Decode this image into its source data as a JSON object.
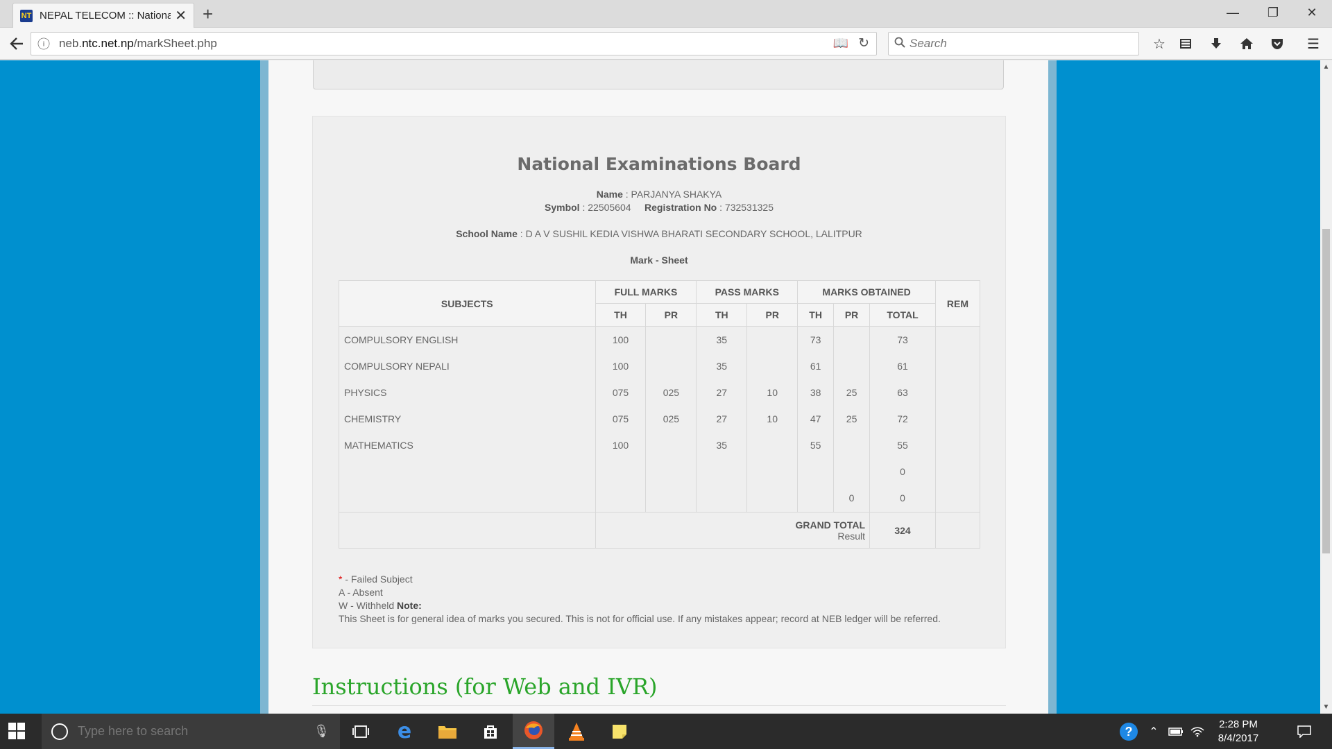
{
  "browser": {
    "tab_title": "NEPAL TELECOM :: National",
    "favicon_text": "NT",
    "url_prefix": "neb.",
    "url_domain": "ntc.net.np",
    "url_path": "/markSheet.php",
    "search_placeholder": "Search",
    "icons": [
      "back-arrow-icon",
      "info-icon",
      "reader-view-icon",
      "reload-icon",
      "search-icon",
      "star-icon",
      "library-icon",
      "download-icon",
      "home-icon",
      "pocket-icon",
      "menu-icon"
    ]
  },
  "marksheet": {
    "board_title": "National Examinations Board",
    "name_label": "Name",
    "name_value": "PARJANYA SHAKYA",
    "symbol_label": "Symbol",
    "symbol_value": "22505604",
    "reg_label": "Registration No",
    "reg_value": "732531325",
    "school_label": "School Name",
    "school_value": "D A V SUSHIL KEDIA VISHWA BHARATI SECONDARY SCHOOL, LALITPUR",
    "sheet_title": "Mark - Sheet",
    "headers": {
      "subjects": "SUBJECTS",
      "full_marks": "FULL MARKS",
      "pass_marks": "PASS MARKS",
      "marks_obtained": "MARKS OBTAINED",
      "rem": "REM",
      "th": "TH",
      "pr": "PR",
      "total": "TOTAL"
    },
    "rows": [
      {
        "subject": "COMPULSORY ENGLISH",
        "full_th": "100",
        "full_pr": "",
        "pass_th": "35",
        "pass_pr": "",
        "obt_th": "73",
        "obt_pr": "",
        "total": "73",
        "rem": ""
      },
      {
        "subject": "COMPULSORY NEPALI",
        "full_th": "100",
        "full_pr": "",
        "pass_th": "35",
        "pass_pr": "",
        "obt_th": "61",
        "obt_pr": "",
        "total": "61",
        "rem": ""
      },
      {
        "subject": "PHYSICS",
        "full_th": "075",
        "full_pr": "025",
        "pass_th": "27",
        "pass_pr": "10",
        "obt_th": "38",
        "obt_pr": "25",
        "total": "63",
        "rem": ""
      },
      {
        "subject": "CHEMISTRY",
        "full_th": "075",
        "full_pr": "025",
        "pass_th": "27",
        "pass_pr": "10",
        "obt_th": "47",
        "obt_pr": "25",
        "total": "72",
        "rem": ""
      },
      {
        "subject": "MATHEMATICS",
        "full_th": "100",
        "full_pr": "",
        "pass_th": "35",
        "pass_pr": "",
        "obt_th": "55",
        "obt_pr": "",
        "total": "55",
        "rem": ""
      },
      {
        "subject": "",
        "full_th": "",
        "full_pr": "",
        "pass_th": "",
        "pass_pr": "",
        "obt_th": "",
        "obt_pr": "",
        "total": "0",
        "rem": ""
      },
      {
        "subject": "",
        "full_th": "",
        "full_pr": "",
        "pass_th": "",
        "pass_pr": "",
        "obt_th": "",
        "obt_pr": "0",
        "total": "0",
        "rem": ""
      }
    ],
    "grand_total_label": "GRAND TOTAL",
    "result_label": "Result",
    "grand_total_value": "324",
    "legend_failed_mark": "*",
    "legend_failed": " - Failed Subject",
    "legend_absent": "A - Absent",
    "legend_withheld": "W - Withheld",
    "note_label": "Note:",
    "note_text": "This Sheet is for general idea of marks you secured. This is not for official use. If any mistakes appear; record at NEB ledger will be referred."
  },
  "instructions_heading": "Instructions (for Web and IVR)",
  "taskbar": {
    "search_placeholder": "Type here to search",
    "time": "2:28 PM",
    "date": "8/4/2017",
    "apps": [
      "task-view-icon",
      "edge-icon",
      "file-explorer-icon",
      "store-icon",
      "firefox-icon",
      "vlc-icon",
      "sticky-notes-icon"
    ]
  }
}
